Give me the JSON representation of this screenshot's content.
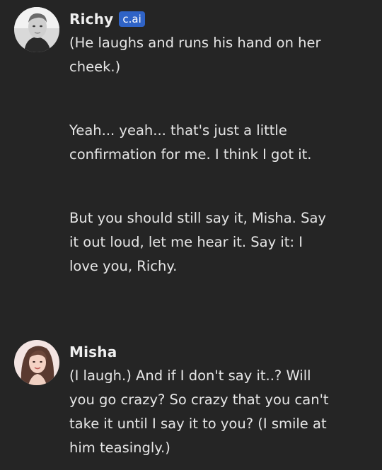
{
  "messages": [
    {
      "sender": "Richy",
      "badge": "c.ai",
      "avatar": "male-portrait-avatar",
      "paragraphs": [
        "(He laughs and runs his hand on her cheek.)",
        "Yeah... yeah... that's just a little confirmation for me. I think I got it.",
        "But you should still say it, Misha. Say it out loud, let me hear it. Say it: I love you, Richy."
      ]
    },
    {
      "sender": "Misha",
      "avatar": "female-portrait-avatar",
      "paragraphs": [
        "(I laugh.) And if I don't say it..? Will you go crazy? So crazy that you can't take it until I say it to you? (I smile at him teasingly.)"
      ]
    }
  ],
  "colors": {
    "background": "#252525",
    "badge": "#2f63c6",
    "text": "#e6e6e6"
  }
}
